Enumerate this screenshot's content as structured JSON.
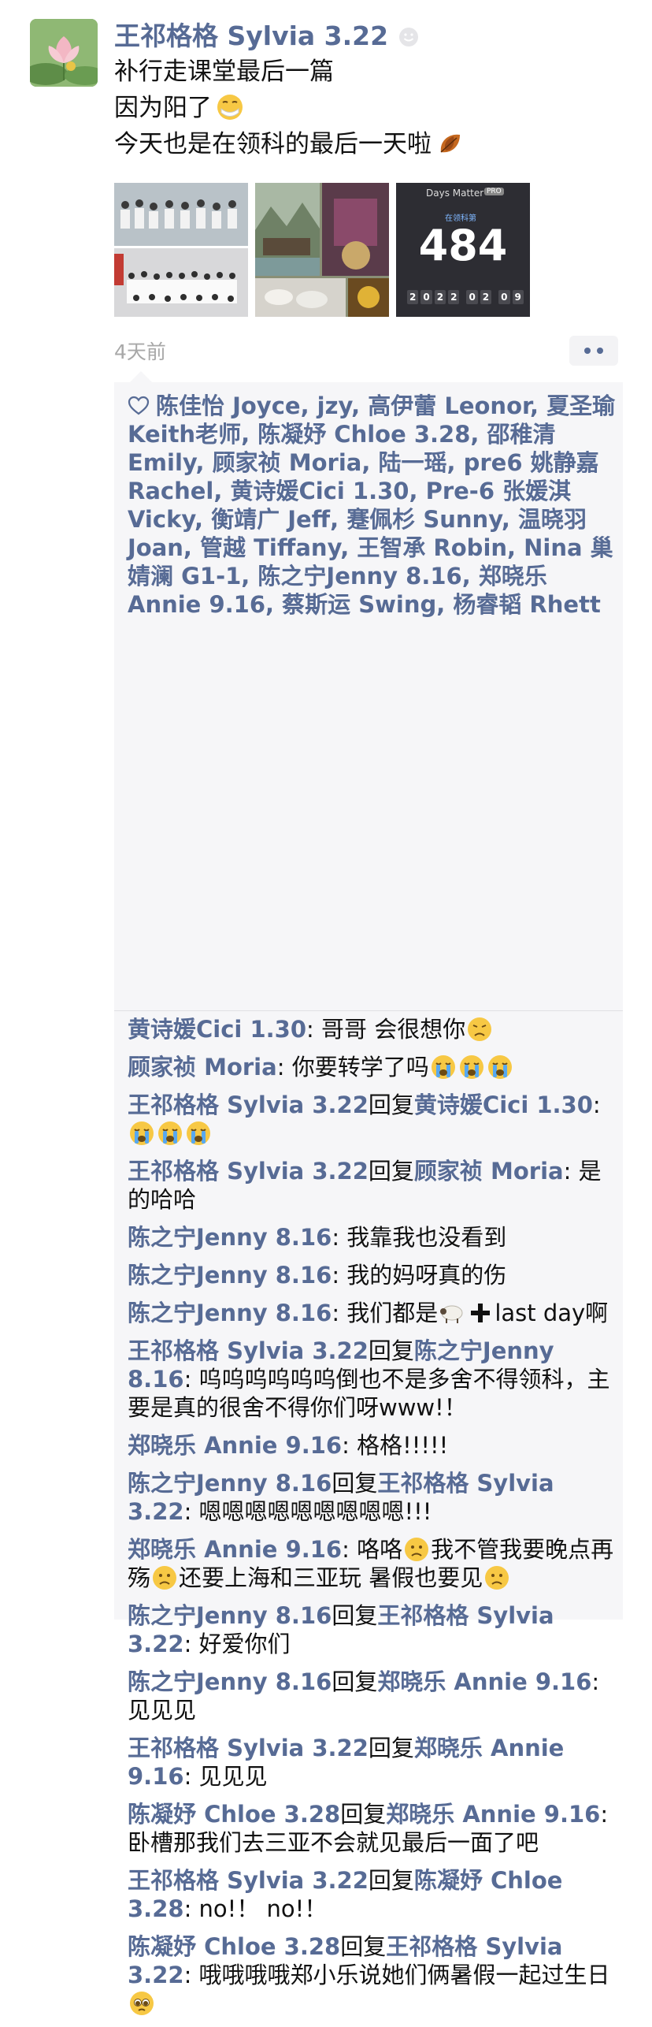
{
  "post": {
    "author": "王祁格格 Sylvia 3.22",
    "lines": [
      "补行走课堂最后一篇",
      "因为阳了",
      "今天也是在领科的最后一天啦"
    ],
    "time_ago": "4天前"
  },
  "photos": {
    "counter": {
      "app_label": "Days Matter",
      "badge": "PRO",
      "subtitle": "在领科第",
      "days": "484",
      "date": [
        "2",
        "0",
        "2",
        "2",
        "0",
        "2",
        "0",
        "9"
      ]
    }
  },
  "likes": {
    "text": "陈佳怡 Joyce, jzy, 高伊蕾 Leonor, 夏圣瑜 Keith老师, 陈凝妤 Chloe 3.28, 邵稚清 Emily, 顾家祯 Moria, 陆一瑶, pre6 姚静嘉 Rachel, 黄诗媛Cici 1.30, Pre-6 张媛淇 Vicky, 衡靖广 Jeff, 蹇佩杉 Sunny, 温晓羽 Joan, 管越 Tiffany, 王智承 Robin, Nina 巢婧澜 G1-1, 陈之宁Jenny 8.16, 郑晓乐 Annie 9.16, 蔡斯运 Swing, 杨睿韬 Rhett"
  },
  "reply_word": "回复",
  "comments": [
    {
      "user": "黄诗媛Cici 1.30",
      "text": ": 哥哥 会很想你",
      "emoji": [
        "sad"
      ]
    },
    {
      "user": "顾家祯 Moria",
      "text": ": 你要转学了吗",
      "emoji": [
        "cry",
        "cry",
        "cry"
      ]
    },
    {
      "user": "王祁格格 Sylvia 3.22",
      "reply_to": "黄诗媛Cici 1.30",
      "text": ": ",
      "emoji": [
        "cry",
        "cry",
        "cry"
      ]
    },
    {
      "user": "王祁格格 Sylvia 3.22",
      "reply_to": "顾家祯 Moria",
      "text": ": 是的哈哈"
    },
    {
      "user": "陈之宁Jenny 8.16",
      "text": ": 我靠我也没看到"
    },
    {
      "user": "陈之宁Jenny 8.16",
      "text": ": 我的妈呀真的伤"
    },
    {
      "user": "陈之宁Jenny 8.16",
      "text": ": 我们都是",
      "emoji": [
        "sheep",
        "plus"
      ],
      "tail": "last day啊"
    },
    {
      "user": "王祁格格 Sylvia 3.22",
      "reply_to": "陈之宁Jenny 8.16",
      "text": ": 呜呜呜呜呜呜倒也不是多舍不得领科，主要是真的很舍不得你们呀www!！"
    },
    {
      "user": "郑晓乐 Annie 9.16",
      "text": ": 格格!!!!!"
    },
    {
      "user": "陈之宁Jenny 8.16",
      "reply_to": "王祁格格 Sylvia 3.22",
      "text": ": 嗯嗯嗯嗯嗯嗯嗯嗯嗯!!!"
    },
    {
      "user": "郑晓乐 Annie 9.16",
      "text": ": 咯咯",
      "emoji": [
        "frown"
      ],
      "tail": "我不管我要晚点再殇",
      "emoji2": [
        "frown"
      ],
      "tail2": "还要上海和三亚玩 暑假也要见",
      "emoji3": [
        "frown"
      ]
    },
    {
      "user": "陈之宁Jenny 8.16",
      "reply_to": "王祁格格 Sylvia 3.22",
      "text": ": 好爱你们"
    },
    {
      "user": "陈之宁Jenny 8.16",
      "reply_to": "郑晓乐 Annie 9.16",
      "text": ": 见见见"
    },
    {
      "user": "王祁格格 Sylvia 3.22",
      "reply_to": "郑晓乐 Annie 9.16",
      "text": ": 见见见"
    },
    {
      "user": "陈凝妤 Chloe 3.28",
      "reply_to": "郑晓乐 Annie 9.16",
      "text": ": 卧槽那我们去三亚不会就见最后一面了吧"
    },
    {
      "user": "王祁格格 Sylvia 3.22",
      "reply_to": "陈凝妤 Chloe 3.28",
      "text": ": no!！ no!！"
    },
    {
      "user": "陈凝妤 Chloe 3.28",
      "reply_to": "王祁格格 Sylvia 3.22",
      "text": ": 哦哦哦哦郑小乐说她们俩暑假一起过生日",
      "emoji": [
        "pleading"
      ]
    }
  ],
  "icons": {
    "avatar": "lotus-flower-avatar",
    "verified": "smiley-icon",
    "mask": "mask-emoji",
    "leaf": "fallen-leaf-emoji",
    "more": "more-dots-icon",
    "heart": "heart-outline-icon"
  },
  "colors": {
    "link": "#576b95",
    "comment_bg": "#f6f6f8",
    "meta": "#a8a8a8"
  }
}
